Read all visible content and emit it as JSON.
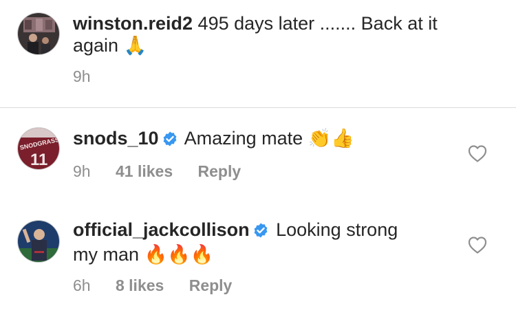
{
  "caption": {
    "username": "winston.reid2",
    "text": "495 days later ....... Back at it",
    "text_line2": "again",
    "emoji": "🙏",
    "time": "9h"
  },
  "comments": [
    {
      "username": "snods_10",
      "verified": true,
      "text": "Amazing mate",
      "emoji": "👏👍",
      "time": "9h",
      "likes": "41 likes",
      "reply": "Reply",
      "avatar_jersey_text": "SNODGRASS",
      "avatar_jersey_number": "11"
    },
    {
      "username": "official_jackcollison",
      "verified": true,
      "text": "Looking strong",
      "text_line2": "my man",
      "emoji": "🔥🔥🔥",
      "time": "6h",
      "likes": "8 likes",
      "reply": "Reply"
    }
  ],
  "colors": {
    "verified_blue": "#3897f0",
    "meta_gray": "#8e8e8e",
    "divider": "#dbdbdb"
  },
  "icons": [
    "verified-badge-icon",
    "heart-outline-icon"
  ]
}
